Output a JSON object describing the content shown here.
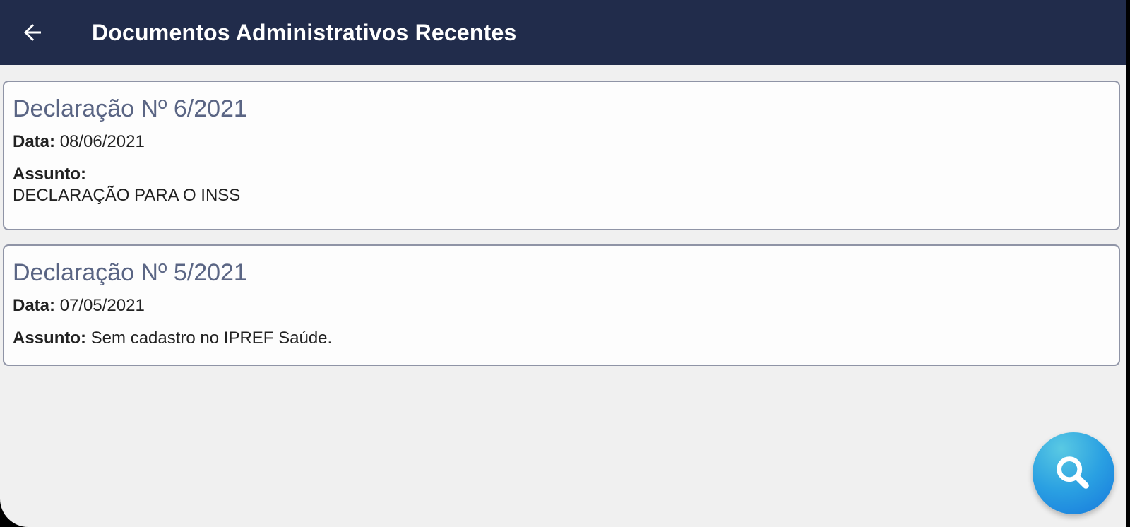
{
  "header": {
    "title": "Documentos Administrativos Recentes",
    "back_icon": "arrow-left-icon",
    "background_color": "#212c4b"
  },
  "documents": [
    {
      "title": "Declaração Nº 6/2021",
      "date_label": "Data:",
      "date": "08/06/2021",
      "subject_label": "Assunto:",
      "subject": "DECLARAÇÃO PARA O INSS"
    },
    {
      "title": "Declaração Nº 5/2021",
      "date_label": "Data:",
      "date": "07/05/2021",
      "subject_label": "Assunto:",
      "subject": "Sem cadastro no IPREF Saúde."
    }
  ],
  "fab": {
    "icon": "search-icon",
    "color": "#2196f3"
  },
  "colors": {
    "background": "#f0f0f0",
    "card_title": "#5a6584",
    "card_border": "#8f94a6"
  }
}
